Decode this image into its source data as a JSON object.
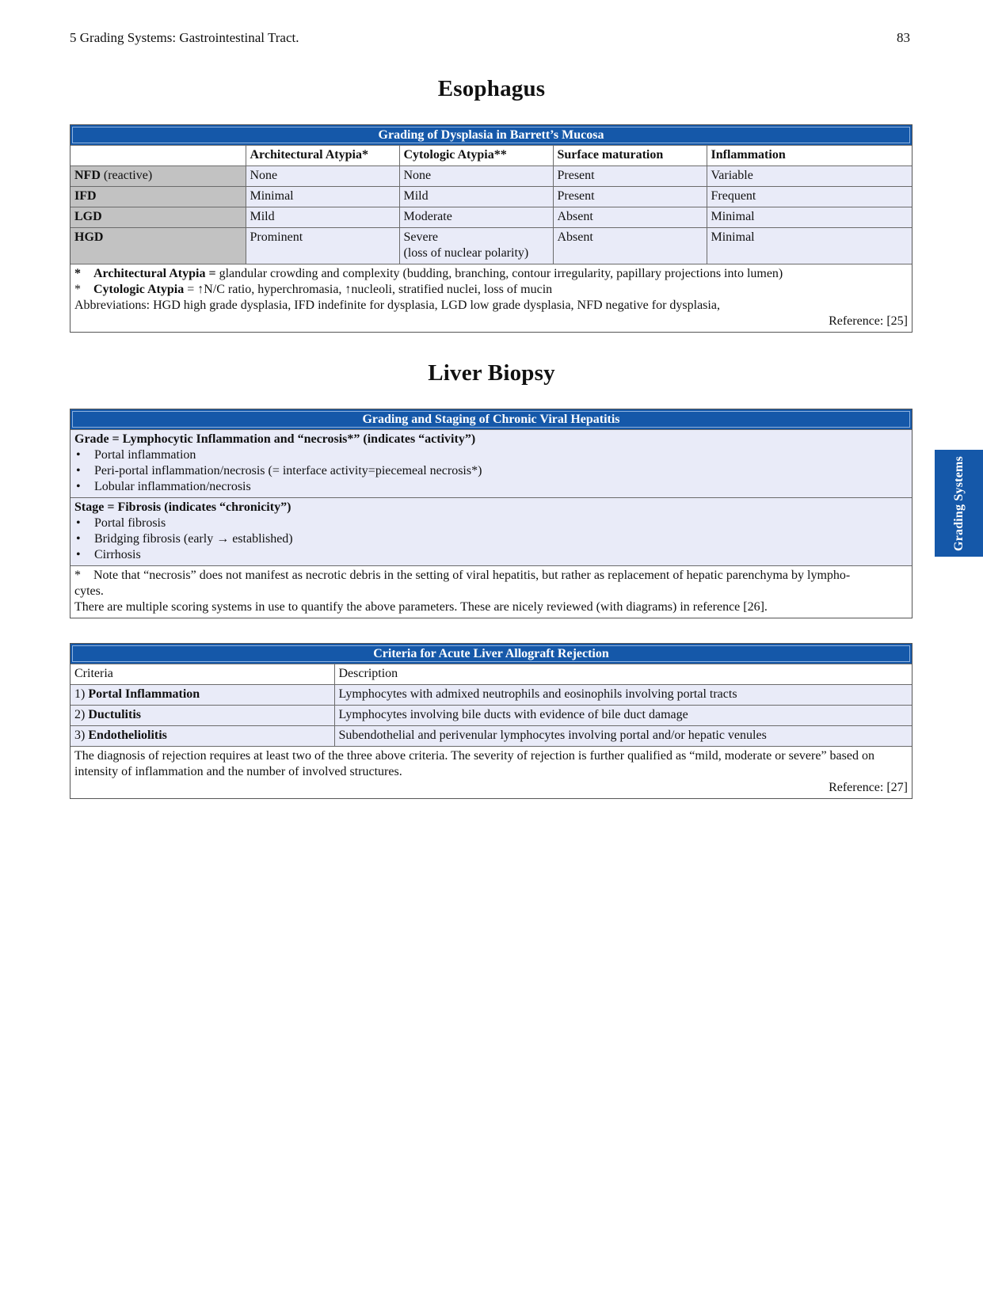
{
  "header": {
    "running_title": "5  Grading Systems: Gastrointestinal Tract.",
    "page_number": "83"
  },
  "side_tab": {
    "label": "Grading Systems"
  },
  "esophagus": {
    "heading": "Esophagus",
    "table": {
      "title": "Grading of Dysplasia in Barrett’s Mucosa",
      "columns": [
        "",
        "Architectural Atypia*",
        "Cytologic Atypia**",
        "Surface maturation",
        "Inflammation"
      ],
      "rows": [
        {
          "label": "NFD",
          "label_suffix": " (reactive)",
          "cells": [
            "None",
            "None",
            "Present",
            "Variable"
          ]
        },
        {
          "label": "IFD",
          "label_suffix": "",
          "cells": [
            "Minimal",
            "Mild",
            "Present",
            "Frequent"
          ]
        },
        {
          "label": "LGD",
          "label_suffix": "",
          "cells": [
            "Mild",
            "Moderate",
            "Absent",
            "Minimal"
          ]
        },
        {
          "label": "HGD",
          "label_suffix": "",
          "cells": [
            "Prominent",
            "Severe",
            "Absent",
            "Minimal"
          ],
          "cells_line2": [
            "",
            "(loss of nuclear polarity)",
            "",
            ""
          ]
        }
      ],
      "notes": [
        {
          "marker": "*",
          "term": "Architectural Atypia",
          "eq": " = ",
          "text": "glandular crowding and complexity (budding, branching, contour irregularity, papillary projections into lumen)"
        },
        {
          "marker": "*",
          "term": "Cytologic Atypia",
          "eq": " = ",
          "text": "↑N/C ratio, hyperchromasia, ↑nucleoli, stratified nuclei, loss of mucin"
        }
      ],
      "abbreviations": "Abbreviations: HGD high grade dysplasia, IFD indefinite for dysplasia, LGD low grade dysplasia, NFD negative for dysplasia,",
      "reference": "Reference: [25]"
    }
  },
  "liver": {
    "heading": "Liver Biopsy",
    "hepatitis_table": {
      "title": "Grading and Staging of Chronic Viral Hepatitis",
      "grade_head": "Grade = Lymphocytic Inflammation and “necrosis*” (indicates “activity”)",
      "grade_items": [
        "Portal inflammation",
        "Peri-portal inflammation/necrosis (= interface activity=piecemeal necrosis*)",
        "Lobular inflammation/necrosis"
      ],
      "stage_head": "Stage = Fibrosis (indicates “chronicity”)",
      "stage_items": [
        "Portal fibrosis",
        "Bridging fibrosis (early → established)",
        "Cirrhosis"
      ],
      "note_marker": "*",
      "note": "Note that “necrosis” does not manifest as necrotic debris in the setting of viral hepatitis, but rather as replacement of hepatic parenchyma by lympho-",
      "note_cont": "cytes.",
      "footer": "There are multiple scoring systems in use to quantify the above parameters. These are nicely reviewed (with diagrams) in reference [26]."
    },
    "rejection_table": {
      "title": "Criteria for Acute Liver Allograft Rejection",
      "columns": [
        "Criteria",
        "Description"
      ],
      "rows": [
        {
          "num": "1) ",
          "name": "Portal Inflammation",
          "desc": "Lymphocytes with admixed neutrophils and eosinophils involving portal tracts"
        },
        {
          "num": "2) ",
          "name": "Ductulitis",
          "desc": "Lymphocytes involving bile ducts with evidence of bile duct damage"
        },
        {
          "num": "3) ",
          "name": "Endotheliolitis",
          "desc": "Subendothelial and perivenular lymphocytes involving portal and/or hepatic venules"
        }
      ],
      "footer": "The diagnosis of rejection requires at least two of the three above criteria. The severity of rejection is further qualified as “mild, moderate or severe” based on intensity of inflammation and the number of involved structures.",
      "reference": "Reference: [27]"
    }
  }
}
